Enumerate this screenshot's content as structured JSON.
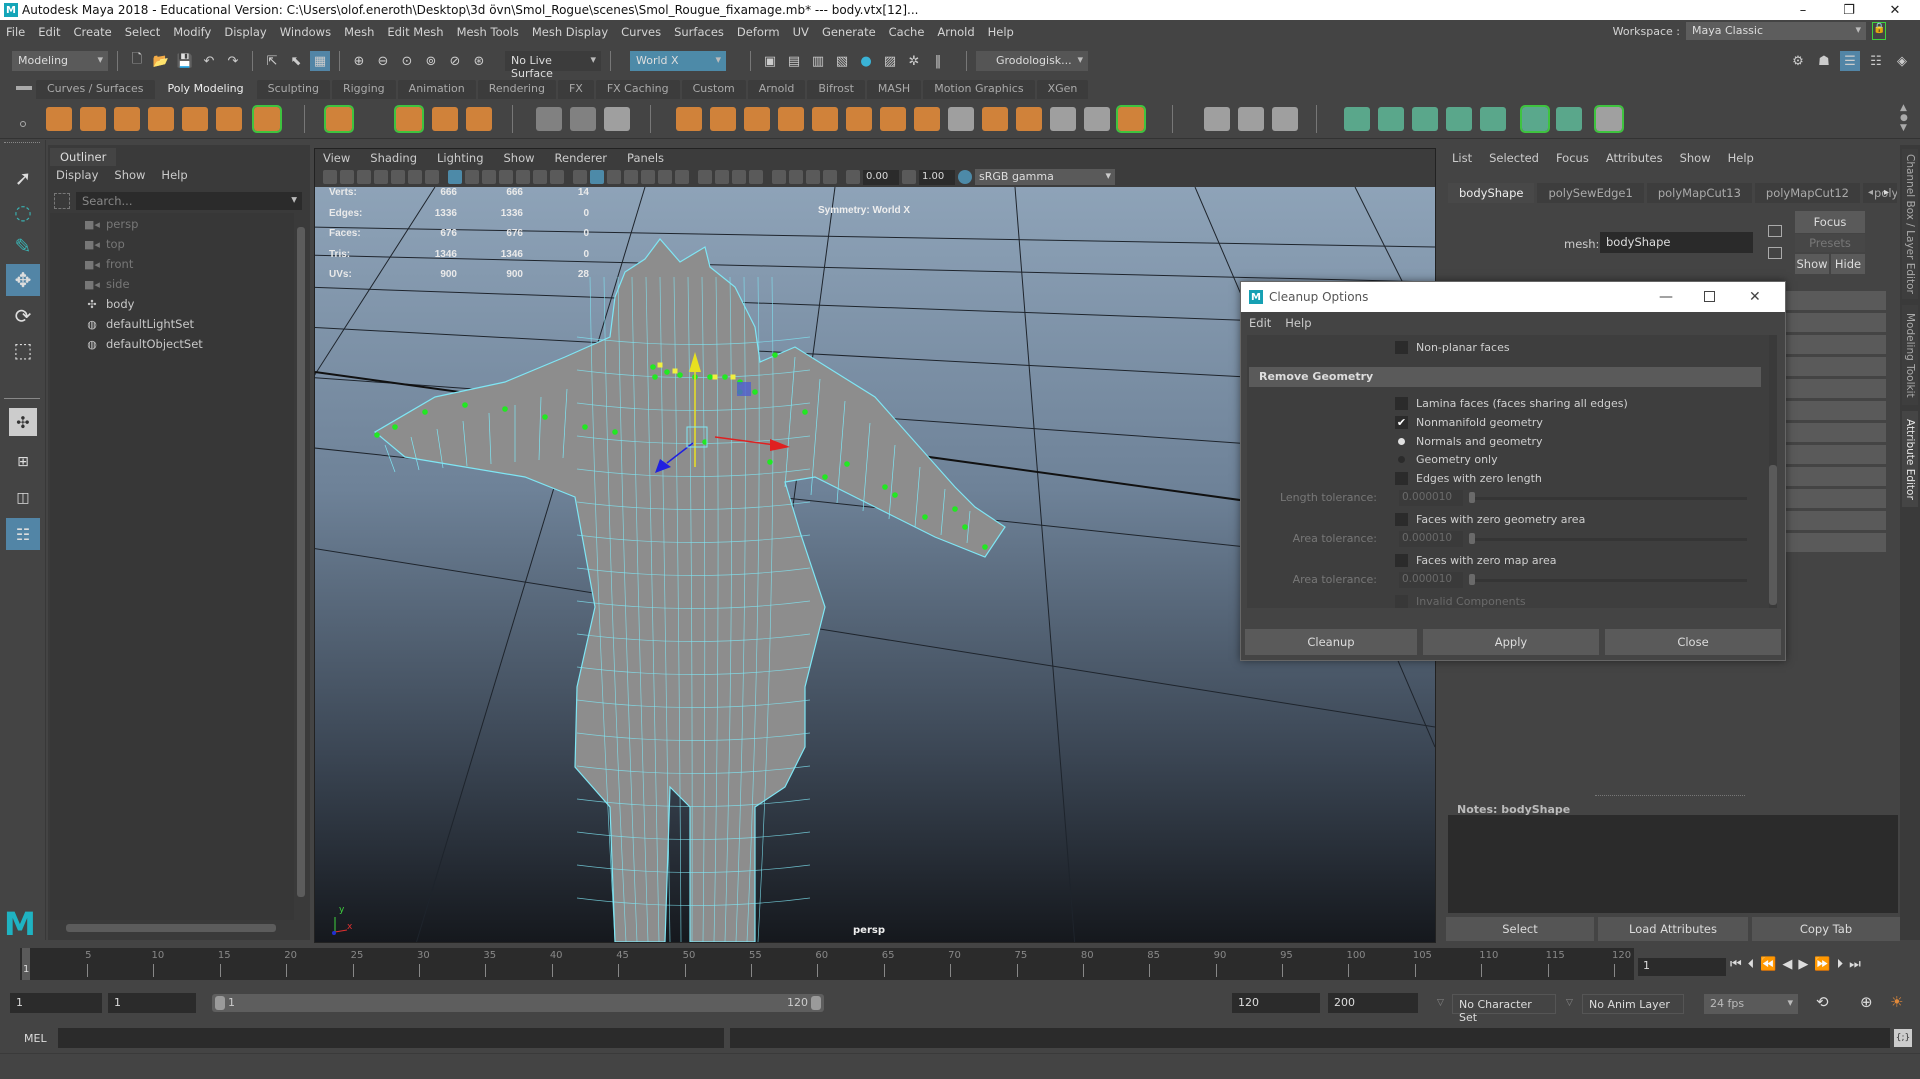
{
  "window": {
    "title": "Autodesk Maya 2018 - Educational Version: C:\\Users\\olof.eneroth\\Desktop\\3d övn\\Smol_Rogue\\scenes\\Smol_Rougue_fixamage.mb*  ---  body.vtx[12]...",
    "minimize": "–",
    "maximize": "❐",
    "close": "✕"
  },
  "menubar": {
    "items": [
      "File",
      "Edit",
      "Create",
      "Select",
      "Modify",
      "Display",
      "Windows",
      "Mesh",
      "Edit Mesh",
      "Mesh Tools",
      "Mesh Display",
      "Curves",
      "Surfaces",
      "Deform",
      "UV",
      "Generate",
      "Cache",
      "Arnold",
      "Help"
    ],
    "workspace_label": "Workspace :",
    "workspace_value": "Maya Classic"
  },
  "statusline": {
    "menuset": "Modeling",
    "live_surface": "No Live Surface",
    "symmetry": "World X",
    "user": "Grodologisk..."
  },
  "shelf": {
    "tabs": [
      "Curves / Surfaces",
      "Poly Modeling",
      "Sculpting",
      "Rigging",
      "Animation",
      "Rendering",
      "FX",
      "FX Caching",
      "Custom",
      "Arnold",
      "Bifrost",
      "MASH",
      "Motion Graphics",
      "XGen"
    ],
    "active_tab": "Poly Modeling",
    "colors": {
      "poly": "#e0893a",
      "uv": "#5db394",
      "highlight": "#3fd13f"
    }
  },
  "outliner": {
    "title": "Outliner",
    "menu": [
      "Display",
      "Show",
      "Help"
    ],
    "search_placeholder": "Search...",
    "items": [
      {
        "label": "persp",
        "icon": "camera-icon",
        "dim": true
      },
      {
        "label": "top",
        "icon": "camera-icon",
        "dim": true
      },
      {
        "label": "front",
        "icon": "camera-icon",
        "dim": true
      },
      {
        "label": "side",
        "icon": "camera-icon",
        "dim": true
      },
      {
        "label": "body",
        "icon": "mesh-transform-icon",
        "dim": false
      },
      {
        "label": "defaultLightSet",
        "icon": "set-icon",
        "dim": false
      },
      {
        "label": "defaultObjectSet",
        "icon": "set-icon",
        "dim": false
      }
    ]
  },
  "viewport": {
    "menu": [
      "View",
      "Shading",
      "Lighting",
      "Show",
      "Renderer",
      "Panels"
    ],
    "exposure": "0.00",
    "gamma": "1.00",
    "color_space": "sRGB gamma",
    "hud": {
      "rows": [
        {
          "label": "Verts:",
          "a": "666",
          "b": "666",
          "c": "14"
        },
        {
          "label": "Edges:",
          "a": "1336",
          "b": "1336",
          "c": "0"
        },
        {
          "label": "Faces:",
          "a": "676",
          "b": "676",
          "c": "0"
        },
        {
          "label": "Tris:",
          "a": "1346",
          "b": "1346",
          "c": "0"
        },
        {
          "label": "UVs:",
          "a": "900",
          "b": "900",
          "c": "28"
        }
      ],
      "symmetry": "Symmetry: World X",
      "camera": "persp",
      "axis_x": "x",
      "axis_y": "y"
    },
    "colors": {
      "wire": "#7fe6f4",
      "vertex": "#22e822",
      "selected_vertex": "#f0f040"
    }
  },
  "attribute_editor": {
    "menu": [
      "List",
      "Selected",
      "Focus",
      "Attributes",
      "Show",
      "Help"
    ],
    "tabs": [
      "bodyShape",
      "polySewEdge1",
      "polyMapCut13",
      "polyMapCut12",
      "polyM"
    ],
    "active_tab": "bodyShape",
    "mesh_label": "mesh:",
    "mesh_value": "bodyShape",
    "focus": "Focus",
    "presets": "Presets",
    "show": "Show",
    "hide": "Hide",
    "notes_label": "Notes:  bodyShape",
    "buttons": [
      "Select",
      "Load Attributes",
      "Copy Tab"
    ]
  },
  "side_tabs": [
    "Channel Box / Layer Editor",
    "Modeling Toolkit",
    "Attribute Editor"
  ],
  "cleanup_dialog": {
    "title": "Cleanup Options",
    "menu": [
      "Edit",
      "Help"
    ],
    "non_planar": {
      "label": "Non-planar faces",
      "checked": false
    },
    "section": "Remove Geometry",
    "options": [
      {
        "type": "checkbox",
        "label": "Lamina faces (faces sharing all edges)",
        "checked": false
      },
      {
        "type": "checkbox",
        "label": "Nonmanifold geometry",
        "checked": true
      },
      {
        "type": "radio",
        "label": "Normals and geometry",
        "checked": true
      },
      {
        "type": "radio",
        "label": "Geometry only",
        "checked": false
      },
      {
        "type": "checkbox",
        "label": "Edges with zero length",
        "checked": false
      }
    ],
    "length_tolerance": {
      "label": "Length tolerance:",
      "value": "0.000010"
    },
    "zero_geom_area": {
      "label": "Faces with zero geometry area",
      "checked": false
    },
    "area_tolerance_1": {
      "label": "Area tolerance:",
      "value": "0.000010"
    },
    "zero_map_area": {
      "label": "Faces with zero map area",
      "checked": false
    },
    "area_tolerance_2": {
      "label": "Area tolerance:",
      "value": "0.000010"
    },
    "invalid_components": {
      "label": "Invalid Components",
      "checked": false
    },
    "buttons": [
      "Cleanup",
      "Apply",
      "Close"
    ]
  },
  "timeline": {
    "ticks": [
      5,
      10,
      15,
      20,
      25,
      30,
      35,
      40,
      45,
      50,
      55,
      60,
      65,
      70,
      75,
      80,
      85,
      90,
      95,
      100,
      105,
      110,
      115,
      120
    ],
    "start": 1,
    "end": 120,
    "current_frame": "1",
    "current_marker": "1"
  },
  "range": {
    "start_time": "1",
    "playback_start": "1",
    "slider_min": "1",
    "slider_max": "120",
    "playback_end": "120",
    "end_time": "200",
    "character_set": "No Character Set",
    "anim_layer": "No Anim Layer",
    "fps": "24 fps"
  },
  "command_line": {
    "label": "MEL",
    "value": ""
  }
}
